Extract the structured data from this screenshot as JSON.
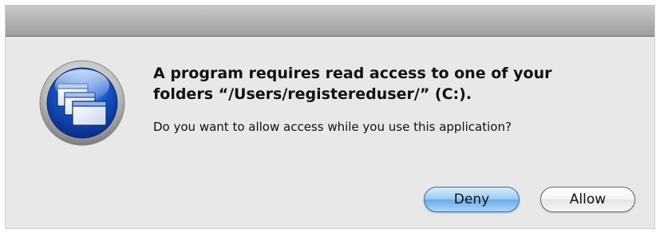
{
  "dialog": {
    "heading_line1": "A program requires read access to one of your",
    "heading_line2": "folders “/Users/registereduser/” (C:).",
    "message": "Do you want to allow access while you use this application?",
    "buttons": {
      "deny_label": "Deny",
      "allow_label": "Allow"
    },
    "icon": "windows-app-icon"
  },
  "colors": {
    "dialog_background": "#e8e8e8",
    "titlebar_gray": "#a8a8a8",
    "default_button_blue": "#7db6ee",
    "icon_blue": "#1a58c9"
  }
}
